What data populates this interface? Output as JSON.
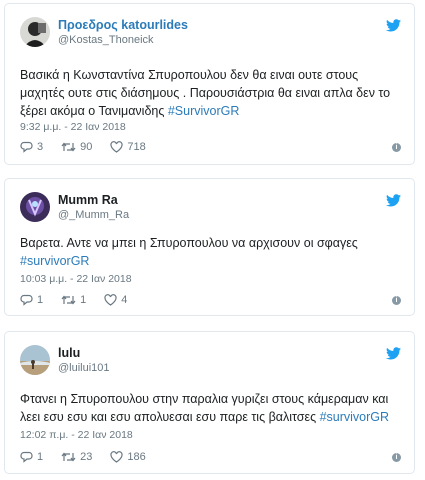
{
  "colors": {
    "link": "#2b7bb9",
    "muted": "#697882",
    "border": "#e1e8ed",
    "bird": "#1da1f2"
  },
  "tweets": [
    {
      "display_name": "Προεδρος katourlides",
      "handle": "@Kostas_Thoneick",
      "text_main": "Βασικά η Κωνσταντίνα Σπυροπουλου δεν θα ειναι ουτε στους μαχητές ουτε στις διάσημους . Παρουσιάστρια θα ειναι απλα δεν το ξέρει ακόμα ο Τανιμανιδης ",
      "hashtag": "#SurvivorGR",
      "timestamp": "9:32 μ.μ. - 22 Ιαν 2018",
      "replies": "3",
      "retweets": "90",
      "likes": "718",
      "avatar_icon": "avatar-photo-dark"
    },
    {
      "display_name": "Mumm Ra",
      "handle": "@_Mumm_Ra",
      "text_main": "Βαρετα. Αντε να μπει η Σπυροπουλου να αρχισουν οι σφαγες ",
      "hashtag": "#survivorGR",
      "timestamp": "10:03 μ.μ. - 22 Ιαν 2018",
      "replies": "1",
      "retweets": "1",
      "likes": "4",
      "avatar_icon": "avatar-photo-purple"
    },
    {
      "display_name": "lulu",
      "handle": "@luilui101",
      "text_main": "Φτανει η Σπυροπουλου στην παραλια γυριζει στους κάμεραμαν και λεει εσυ εσυ και εσυ απολυεσαι εσυ παρε τις βαλιτσες ",
      "hashtag": "#survivorGR",
      "timestamp": "12:02 π.μ. - 22 Ιαν 2018",
      "replies": "1",
      "retweets": "23",
      "likes": "186",
      "avatar_icon": "avatar-photo-beach"
    }
  ],
  "icons": {
    "brand": "twitter-bird-icon",
    "reply": "reply-icon",
    "retweet": "retweet-icon",
    "like": "heart-icon",
    "info": "info-icon"
  }
}
